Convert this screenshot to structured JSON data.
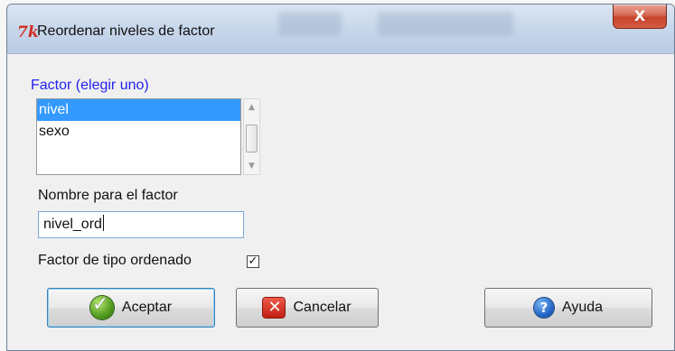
{
  "window": {
    "title": "Reordenar niveles de factor",
    "close_label": "X"
  },
  "factor_list": {
    "label": "Factor (elegir uno)",
    "items": [
      "nivel",
      "sexo"
    ],
    "selected": "nivel"
  },
  "factor_name": {
    "label": "Nombre para el factor",
    "value": "nivel_ord"
  },
  "ordered": {
    "label": "Factor de tipo ordenado",
    "checked": true,
    "mark": "✓"
  },
  "buttons": {
    "accept": "Aceptar",
    "cancel": "Cancelar",
    "help": "Ayuda"
  },
  "icons": {
    "app": "tk-icon",
    "accept": "check-circle-icon",
    "cancel": "x-square-icon",
    "help": "help-icon"
  },
  "colors": {
    "selection": "#3399ff",
    "label_accent": "#2222ee",
    "close_button": "#c7432b"
  }
}
